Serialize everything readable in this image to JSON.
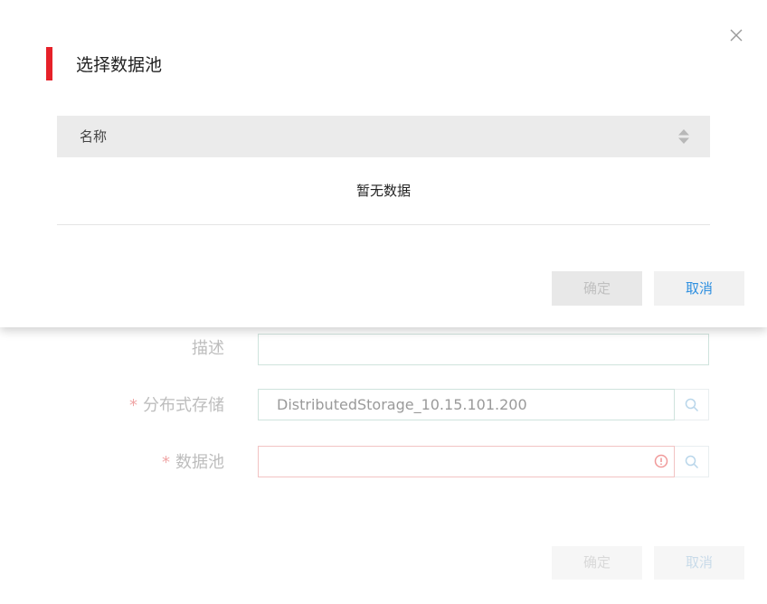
{
  "background_form": {
    "description_label": "描述",
    "storage_label": "分布式存储",
    "storage_value": "DistributedStorage_10.15.101.200",
    "pool_label": "数据池",
    "pool_value": "",
    "required_mark": "*",
    "confirm_label": "确定",
    "cancel_label": "取消"
  },
  "modal": {
    "title": "选择数据池",
    "table": {
      "columns": [
        "名称"
      ],
      "empty_text": "暂无数据"
    },
    "confirm_label": "确定",
    "cancel_label": "取消",
    "close_icon": "close-icon"
  },
  "colors": {
    "accent_red": "#e62129",
    "link_blue": "#2d8fe0",
    "header_gray": "#ebebeb"
  }
}
